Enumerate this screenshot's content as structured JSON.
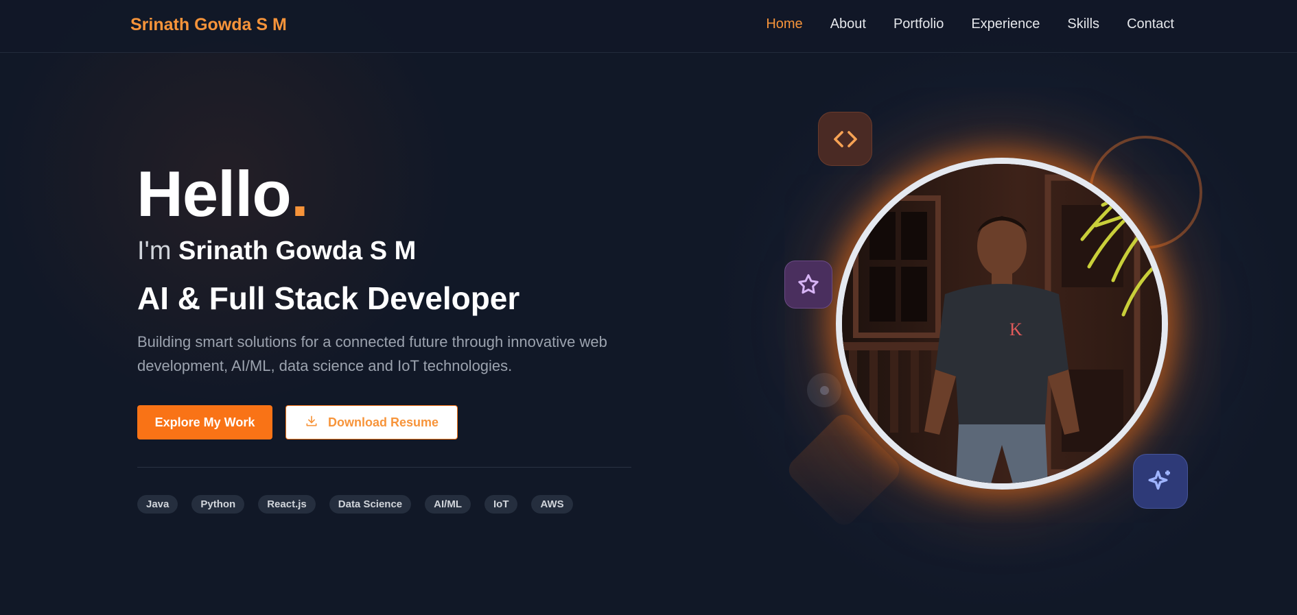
{
  "header": {
    "brand": "Srinath Gowda S M",
    "nav": [
      {
        "label": "Home",
        "active": true
      },
      {
        "label": "About",
        "active": false
      },
      {
        "label": "Portfolio",
        "active": false
      },
      {
        "label": "Experience",
        "active": false
      },
      {
        "label": "Skills",
        "active": false
      },
      {
        "label": "Contact",
        "active": false
      }
    ]
  },
  "hero": {
    "greeting": "Hello",
    "greeting_dot": ".",
    "intro_prefix": "I'm",
    "name": "Srinath Gowda S M",
    "role": "AI & Full Stack Developer",
    "description": "Building smart solutions for a connected future through innovative web development, AI/ML, data science and IoT technologies.",
    "primary_button": "Explore My Work",
    "secondary_button": "Download Resume",
    "tags": [
      "Java",
      "Python",
      "React.js",
      "Data Science",
      "AI/ML",
      "IoT",
      "AWS"
    ]
  },
  "icons": {
    "download": "download-icon",
    "code": "code-icon",
    "star": "star-icon",
    "sparkle": "sparkle-icon"
  },
  "colors": {
    "accent": "#f97316",
    "background": "#111827"
  }
}
